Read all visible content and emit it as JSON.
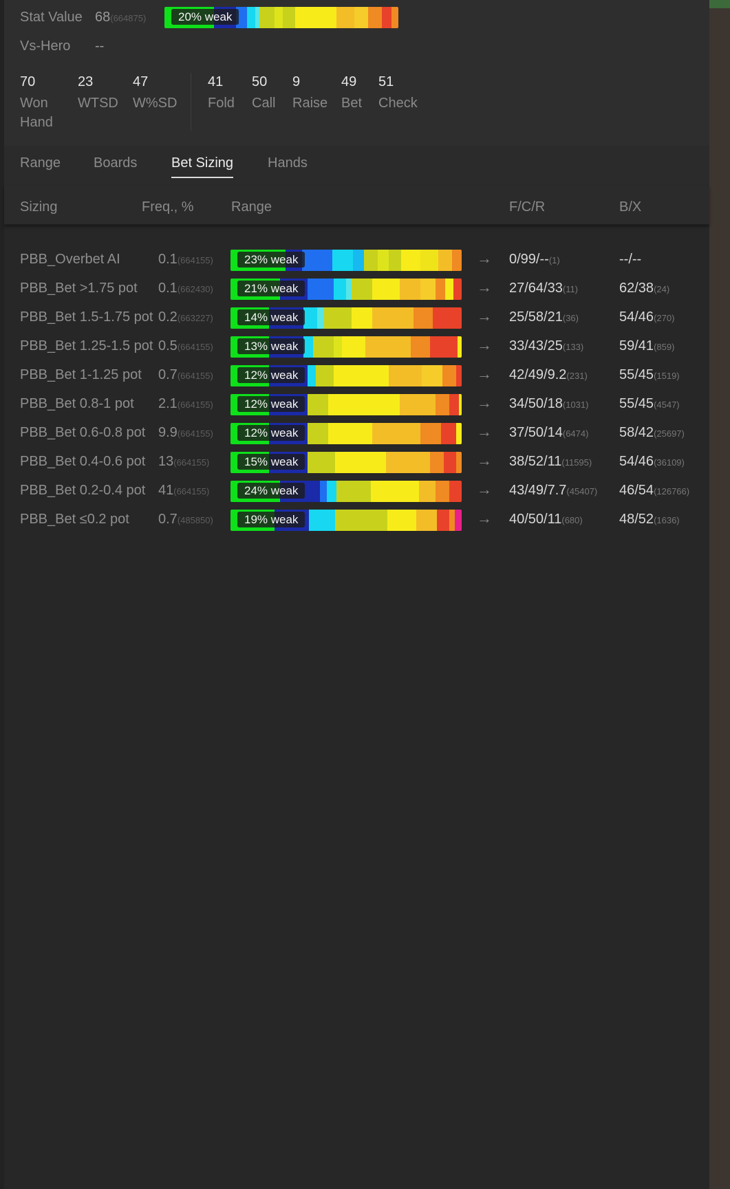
{
  "stats": {
    "stat_value_label": "Stat Value",
    "stat_value": "68",
    "stat_value_sample": "(664875)",
    "stat_bar_label": "20% weak",
    "vs_hero_label": "Vs-Hero",
    "vs_hero_value": "--"
  },
  "counters": [
    {
      "num": "70",
      "label": "Won Hand"
    },
    {
      "num": "23",
      "label": "WTSD"
    },
    {
      "num": "47",
      "label": "W%SD"
    },
    {
      "num": "41",
      "label": "Fold"
    },
    {
      "num": "50",
      "label": "Call"
    },
    {
      "num": "9",
      "label": "Raise"
    },
    {
      "num": "49",
      "label": "Bet"
    },
    {
      "num": "51",
      "label": "Check"
    }
  ],
  "tabs": [
    {
      "label": "Range",
      "active": false
    },
    {
      "label": "Boards",
      "active": false
    },
    {
      "label": "Bet Sizing",
      "active": true
    },
    {
      "label": "Hands",
      "active": false
    }
  ],
  "table": {
    "headers": {
      "sizing": "Sizing",
      "freq": "Freq., %",
      "range": "Range",
      "fcr": "F/C/R",
      "bx": "B/X"
    },
    "arrow_glyph": "→",
    "rows": [
      {
        "name": "PBB_Overbet AI",
        "freq": "0.1",
        "freq_sample": "(664155)",
        "weak": "23% weak",
        "fcr": "0/99/--",
        "fcr_sample": "(1)",
        "bx": "--/--",
        "bx_sample": ""
      },
      {
        "name": "PBB_Bet >1.75 pot",
        "freq": "0.1",
        "freq_sample": "(662430)",
        "weak": "21% weak",
        "fcr": "27/64/33",
        "fcr_sample": "(11)",
        "bx": "62/38",
        "bx_sample": "(24)"
      },
      {
        "name": "PBB_Bet 1.5-1.75 pot",
        "freq": "0.2",
        "freq_sample": "(663227)",
        "weak": "14% weak",
        "fcr": "25/58/21",
        "fcr_sample": "(36)",
        "bx": "54/46",
        "bx_sample": "(270)"
      },
      {
        "name": "PBB_Bet 1.25-1.5 pot",
        "freq": "0.5",
        "freq_sample": "(664155)",
        "weak": "13% weak",
        "fcr": "33/43/25",
        "fcr_sample": "(133)",
        "bx": "59/41",
        "bx_sample": "(859)"
      },
      {
        "name": "PBB_Bet 1-1.25 pot",
        "freq": "0.7",
        "freq_sample": "(664155)",
        "weak": "12% weak",
        "fcr": "42/49/9.2",
        "fcr_sample": "(231)",
        "bx": "55/45",
        "bx_sample": "(1519)"
      },
      {
        "name": "PBB_Bet 0.8-1 pot",
        "freq": "2.1",
        "freq_sample": "(664155)",
        "weak": "12% weak",
        "fcr": "34/50/18",
        "fcr_sample": "(1031)",
        "bx": "55/45",
        "bx_sample": "(4547)"
      },
      {
        "name": "PBB_Bet 0.6-0.8 pot",
        "freq": "9.9",
        "freq_sample": "(664155)",
        "weak": "12% weak",
        "fcr": "37/50/14",
        "fcr_sample": "(6474)",
        "bx": "58/42",
        "bx_sample": "(25697)"
      },
      {
        "name": "PBB_Bet 0.4-0.6 pot",
        "freq": "13",
        "freq_sample": "(664155)",
        "weak": "15% weak",
        "fcr": "38/52/11",
        "fcr_sample": "(11595)",
        "bx": "54/46",
        "bx_sample": "(36109)"
      },
      {
        "name": "PBB_Bet 0.2-0.4 pot",
        "freq": "41",
        "freq_sample": "(664155)",
        "weak": "24% weak",
        "fcr": "43/49/7.7",
        "fcr_sample": "(45407)",
        "bx": "46/54",
        "bx_sample": "(126766)"
      },
      {
        "name": "PBB_Bet ≤0.2 pot",
        "freq": "0.7",
        "freq_sample": "(485850)",
        "weak": "19% weak",
        "fcr": "40/50/11",
        "fcr_sample": "(680)",
        "bx": "48/52",
        "bx_sample": "(1636)"
      }
    ]
  },
  "colors": {
    "weak_green": "#0ee01a",
    "weak_dark_blue": "#1b2aa8",
    "blue": "#1f6ff0",
    "cyan": "#17d8f0",
    "olive": "#c8d21c",
    "yellow": "#f7ec1a",
    "amber": "#f3bd28",
    "orange": "#f08a22",
    "red_orange": "#e8432a",
    "magenta": "#e8208a"
  }
}
